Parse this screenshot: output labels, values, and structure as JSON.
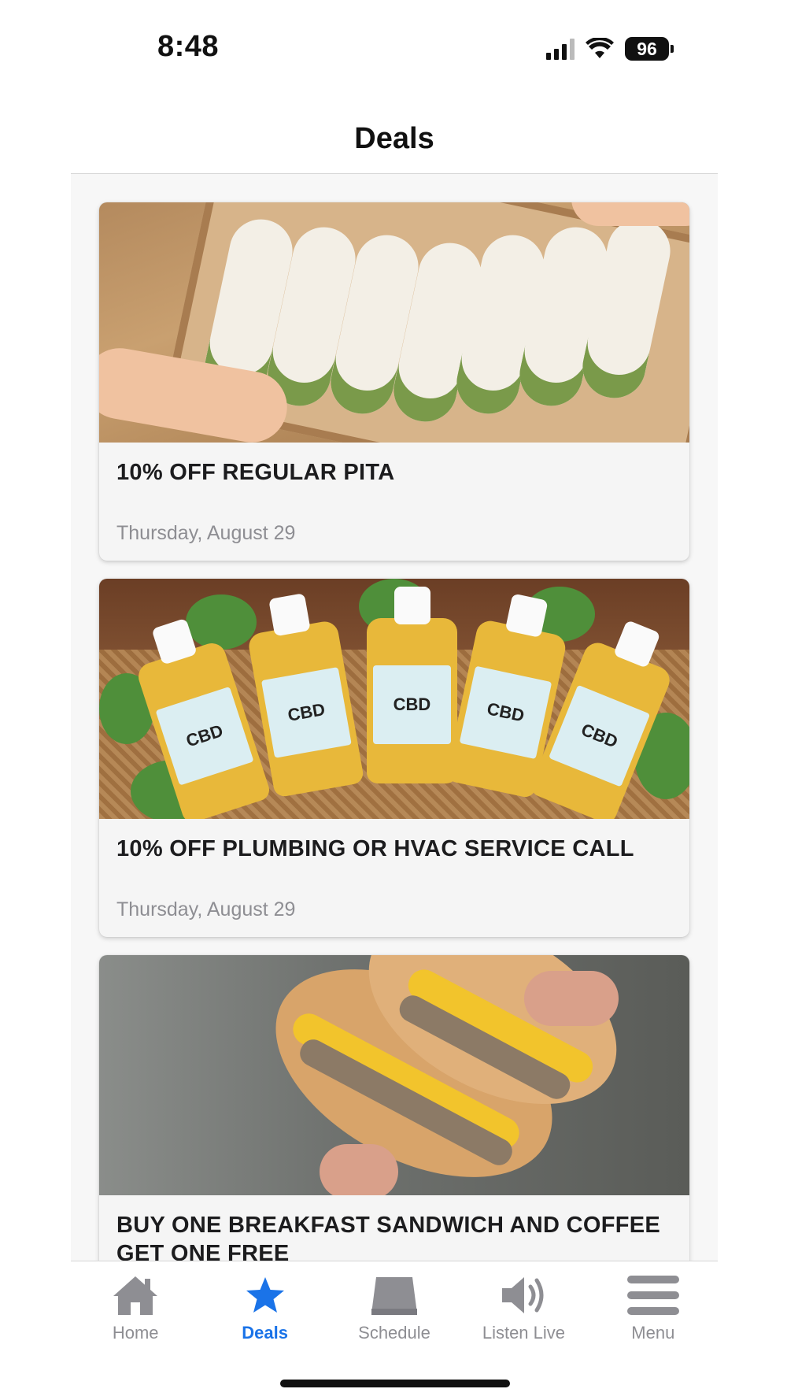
{
  "status_bar": {
    "time": "8:48",
    "battery": "96"
  },
  "header": {
    "title": "Deals"
  },
  "deals": [
    {
      "title": "10% OFF REGULAR PITA",
      "date": "Thursday, August 29",
      "image": "pita-wraps-photo"
    },
    {
      "title": "10% OFF PLUMBING OR HVAC SERVICE CALL",
      "date": "Thursday, August 29",
      "image": "cbd-oil-bottles-photo"
    },
    {
      "title": "BUY ONE BREAKFAST SANDWICH AND COFFEE GET ONE FREE",
      "date": "",
      "image": "breakfast-sandwich-photo"
    }
  ],
  "cbd_label": "CBD",
  "tabs": [
    {
      "label": "Home",
      "icon": "house-icon",
      "active": false
    },
    {
      "label": "Deals",
      "icon": "star-icon",
      "active": true
    },
    {
      "label": "Schedule",
      "icon": "calendar-icon",
      "active": false
    },
    {
      "label": "Listen Live",
      "icon": "speaker-icon",
      "active": false
    },
    {
      "label": "Menu",
      "icon": "hamburger-icon",
      "active": false
    }
  ],
  "colors": {
    "accent": "#1a73e8",
    "inactive": "#8e8e93"
  }
}
